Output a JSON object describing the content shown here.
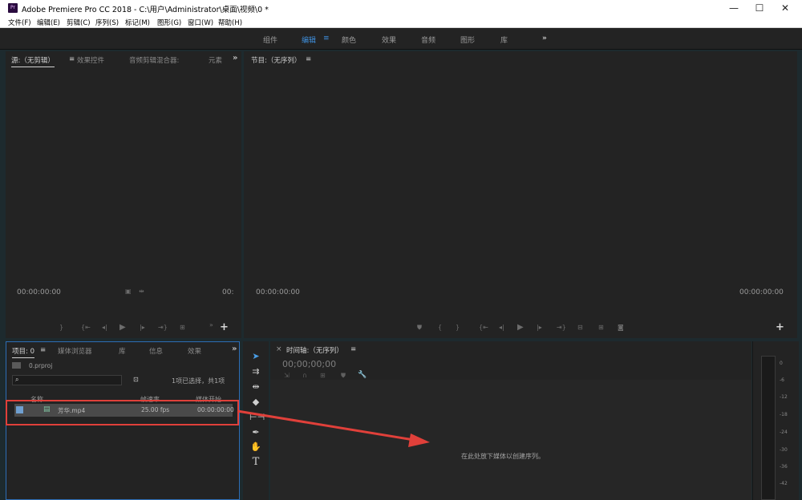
{
  "titlebar": {
    "app_icon": "Pr",
    "title": "Adobe Premiere Pro CC 2018 - C:\\用户\\Administrator\\桌面\\视频\\0 *",
    "minimize": "—",
    "maximize": "☐",
    "close": "✕"
  },
  "menu": [
    "文件(F)",
    "编辑(E)",
    "剪辑(C)",
    "序列(S)",
    "标记(M)",
    "图形(G)",
    "窗口(W)",
    "帮助(H)"
  ],
  "workspaces": [
    "组件",
    "编辑",
    "颜色",
    "效果",
    "音频",
    "图形",
    "库"
  ],
  "workspace_active": "编辑",
  "workspace_menu_icon": "≡",
  "workspace_more": "»",
  "source_panel": {
    "tabs": [
      "源:（无剪辑）",
      "效果控件",
      "音频剪辑混合器:",
      "元素"
    ],
    "menu_icon": "≡",
    "more": "»",
    "timecode_left": "00:00:00:00",
    "timecode_right": "00:"
  },
  "program_panel": {
    "title": "节目:（无序列）",
    "menu_icon": "≡",
    "timecode_left": "00:00:00:00",
    "timecode_right": "00:00:00:00"
  },
  "project_panel": {
    "tabs": [
      "项目: 0",
      "媒体浏览器",
      "库",
      "信息",
      "效果"
    ],
    "menu_icon": "≡",
    "more": "»",
    "project_file": "0.prproj",
    "search_placeholder": "",
    "selection_info": "1项已选择，共1项",
    "columns": [
      "名称",
      "帧速率",
      "媒体开始"
    ],
    "clip": {
      "name": "芳华.mp4",
      "frame_rate": "25.00 fps",
      "media_start": "00:00:00:00"
    }
  },
  "timeline_panel": {
    "close": "×",
    "title": "时间轴:（无序列）",
    "menu_icon": "≡",
    "timecode": "00;00;00;00",
    "drop_hint": "在此处放下媒体以创建序列。"
  },
  "meter_labels": [
    "0",
    "-6",
    "-12",
    "-18",
    "-24",
    "-30",
    "-36",
    "-42"
  ],
  "colors": {
    "accent": "#3f8fdc",
    "highlight_box": "#e0403a",
    "panel_bg": "#232323"
  }
}
